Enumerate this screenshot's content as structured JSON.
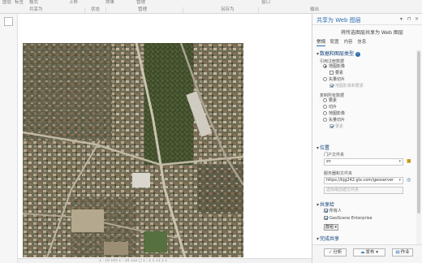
{
  "ribbon": {
    "items": [
      "图层",
      "标签",
      "格式",
      "上移",
      "效果",
      "管理",
      "窗口"
    ],
    "groups": [
      "共享为",
      "状态",
      "管理",
      "另存为",
      "输出"
    ]
  },
  "status_bar": {
    "text": "1 : 10 105  1 : 10 132  ◻ 1 : 1 1 11 1 1"
  },
  "pane": {
    "title": "共享为 Web 图层",
    "header_icons": {
      "menu": "▾",
      "pin": "⊓",
      "close": "×"
    },
    "subtitle": "将所选图层共享为 Web 图层",
    "tabs": [
      "常规",
      "配置",
      "内容",
      "信息"
    ],
    "data_layer_type": {
      "heading": "数据和图层类型",
      "reference_label": "引用注册数据",
      "reference_options": [
        "地图影像",
        "要素",
        "矢量切片"
      ],
      "reference_sub_option": "地图影像和要素",
      "copy_label": "复制所有数据",
      "copy_options": [
        "要素",
        "切片",
        "地图影像",
        "矢量切片"
      ],
      "copy_sub_option": "要素"
    },
    "location": {
      "heading": "位置",
      "portal_folder_label": "门户文件夹",
      "portal_folder_value": "zn",
      "server_folder_label": "服务器和文件夹",
      "server_url": "https://kjg242.glx.com/geoserver",
      "folder_placeholder": "选择或创建文件夹"
    },
    "sharing": {
      "heading": "共享给",
      "owner_label": "所有人",
      "enterprise_label": "GeoScene Enterprise",
      "group_button": "群组"
    },
    "finish_heading": "完成共享",
    "footer": {
      "analyze": "分析",
      "publish": "发布",
      "jobs": "作业"
    }
  },
  "colors": {
    "accent": "#2b6cb0",
    "heading": "#0e3f78",
    "folder_icon": "#c89b1b"
  },
  "icons": [
    "info-icon",
    "folder-icon",
    "globe-icon",
    "check-icon",
    "dropdown-icon"
  ]
}
